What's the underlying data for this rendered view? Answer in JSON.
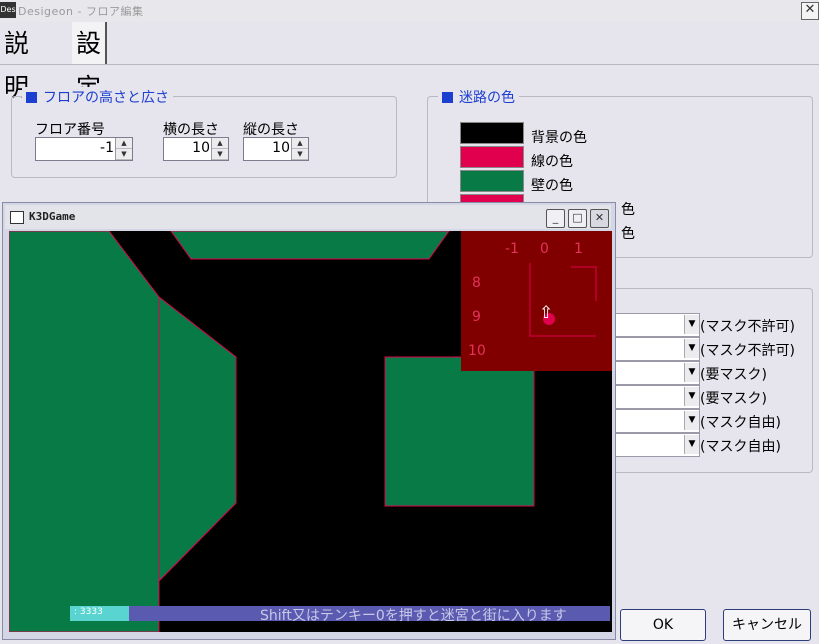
{
  "window": {
    "title": "Desigeon - フロア編集",
    "icon_text": "Des",
    "close_symbol": "✕"
  },
  "tabs": [
    {
      "label": "説明"
    },
    {
      "label": "設定"
    }
  ],
  "floor_group": {
    "legend": "フロアの高さと広さ",
    "floor_number": {
      "label": "フロア番号",
      "value": "-1"
    },
    "width": {
      "label": "横の長さ",
      "value": "10"
    },
    "height": {
      "label": "縦の長さ",
      "value": "10"
    }
  },
  "maze_colors": {
    "legend": "迷路の色",
    "items": [
      {
        "label": "背景の色",
        "color": "#000000"
      },
      {
        "label": "線の色",
        "color": "#e0004e"
      },
      {
        "label": "壁の色",
        "color": "#087a45"
      },
      {
        "label": "色",
        "color": "#e0004e"
      },
      {
        "label": "色",
        "color": "#e0004e"
      }
    ]
  },
  "dropdowns": [
    {
      "note": "(マスク不許可)"
    },
    {
      "note": "(マスク不許可)"
    },
    {
      "note": "(要マスク)"
    },
    {
      "note": "(要マスク)"
    },
    {
      "note": "(マスク自由)"
    },
    {
      "note": "(マスク自由)"
    }
  ],
  "buttons": {
    "ok": "OK",
    "cancel": "キャンセル"
  },
  "game": {
    "title": "K3DGame",
    "minimize_symbol": "_",
    "maximize_symbol": "□",
    "close_symbol": "✕",
    "minimap": {
      "columns": [
        "-1",
        "0",
        "1"
      ],
      "rows": [
        "8",
        "9",
        "10"
      ],
      "player_arrow": "⇧"
    },
    "status_hp": ": 3333",
    "hint": "Shift又はテンキー0を押すと迷宮と街に入ります"
  },
  "colors": {
    "wall": "#087a45",
    "line": "#e0004e",
    "background": "#000000",
    "minimap_bg": "#800000",
    "legend_accent": "#1d3fd0"
  }
}
